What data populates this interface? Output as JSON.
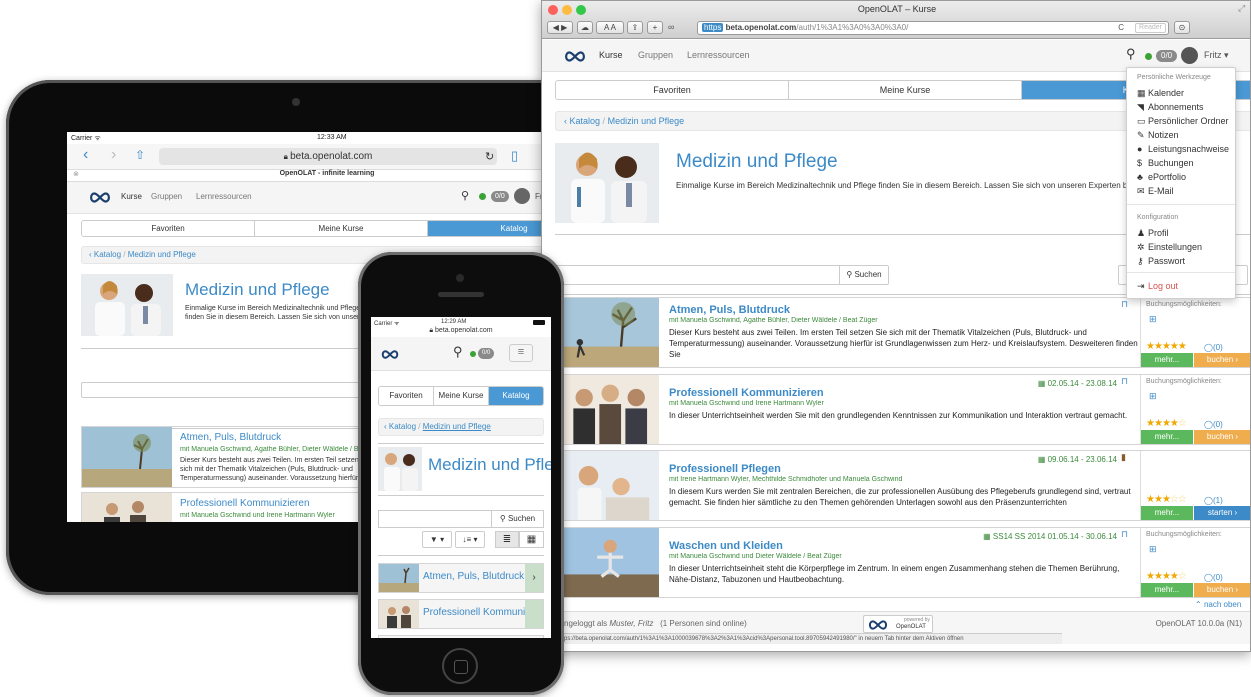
{
  "tablet": {
    "status": {
      "carrier": "Carrier ᯤ",
      "time": "12:33 AM"
    },
    "url": "beta.openolat.com",
    "page_title": "OpenOLAT - infinite learning",
    "nav": {
      "kurse": "Kurse",
      "gruppen": "Gruppen",
      "lern": "Lernressourcen",
      "badge": "0/0",
      "user": "Fr"
    },
    "tabs": [
      "Favoriten",
      "Meine Kurse",
      "Katalog"
    ],
    "crumb": {
      "katalog": "Katalog",
      "sep": "/",
      "current": "Medizin und Pflege"
    },
    "heading": "Medizin und Pflege",
    "desc": "Einmalige Kurse im Bereich Medizinaltechnik und Pflege finden Sie in diesem Bereich. Lassen Sie sich von unseren Experten begleiten und ausbilden.",
    "courses": [
      {
        "title": "Atmen, Puls, Blutdruck",
        "authors": "mit Manuela Gschwind, Agathe Bühler, Dieter Wäldele / Beat Züger",
        "text": "Dieser Kurs besteht aus zwei Teilen. Im ersten Teil setzen Sie sich mit der Thematik Vitalzeichen (Puls, Blutdruck- und Temperaturmessung) auseinander. Voraussetzung hierfür ist Grundlagenwissen zum Herz- und Kreislaufsystem. Desweiteren finden Sie"
      },
      {
        "title": "Professionell Kommunizieren",
        "authors": "mit Manuela Gschwind und Irene Hartmann Wyler"
      }
    ]
  },
  "phone": {
    "status": {
      "carrier": "Carrier ᯤ",
      "time": "12:29 AM"
    },
    "url": "beta.openolat.com",
    "badge": "0/0",
    "tabs": [
      "Favoriten",
      "Meine Kurse",
      "Katalog"
    ],
    "crumb": {
      "katalog": "Katalog",
      "sep": "/",
      "current": "Medizin und Pflege"
    },
    "heading": "Medizin und Pflege",
    "search": "Suchen",
    "courses": [
      "Atmen, Puls, Blutdruck",
      "Professionell Kommunizieren"
    ]
  },
  "browser": {
    "window_title": "OpenOLAT – Kurse",
    "url_prefix": "https",
    "url_host": "beta.openolat.com",
    "url_path": "/auth/1%3A1%3A0%3A0%3A0/",
    "reader": "Reader",
    "reload": "C",
    "nav": {
      "kurse": "Kurse",
      "gruppen": "Gruppen",
      "lern": "Lernressourcen",
      "badge": "0/0",
      "user": "Fritz ▾"
    },
    "tabs": [
      "Favoriten",
      "Meine Kurse",
      "Katalog"
    ],
    "crumb": {
      "katalog": "Katalog",
      "sep": "/",
      "current": "Medizin und Pflege"
    },
    "heading": "Medizin und Pflege",
    "desc": "Einmalige Kurse im Bereich Medizinaltechnik und Pflege finden Sie in diesem Bereich. Lassen Sie sich von unseren Experten begleiten und ausbilden.",
    "search_button": "Suchen",
    "menu": {
      "header1": "Persönliche Werkzeuge",
      "items1": [
        "Kalender",
        "Abonnements",
        "Persönlicher Ordner",
        "Notizen",
        "Leistungsnachweise",
        "Buchungen",
        "ePortfolio",
        "E-Mail"
      ],
      "header2": "Konfiguration",
      "items2": [
        "Profil",
        "Einstellungen",
        "Passwort"
      ],
      "logout": "Log out"
    },
    "courses": [
      {
        "title": "Atmen, Puls, Blutdruck",
        "date": "",
        "authors": "mit Manuela Gschwind, Agathe Bühler, Dieter Wäldele / Beat Züger",
        "text": "Dieser Kurs besteht aus zwei Teilen. Im ersten Teil setzen Sie sich mit der Thematik Vitalzeichen (Puls, Blutdruck- und Temperaturmessung) auseinander. Voraussetzung hierfür ist Grundlagenwissen zum Herz- und Kreislaufsystem. Desweiteren finden Sie",
        "side_label": "Buchungsmöglichkeiten:",
        "rating": 5,
        "comments": "(0)",
        "btn1": "mehr...",
        "btn2": "buchen ›"
      },
      {
        "title": "Professionell Kommunizieren",
        "date": "02.05.14 - 23.08.14",
        "authors": "mit Manuela Gschwind und Irene Hartmann Wyler",
        "text": "In dieser Unterrichtseinheit werden Sie mit den grundlegenden Kenntnissen zur Kommunikation und Interaktion vertraut gemacht.",
        "side_label": "Buchungsmöglichkeiten:",
        "rating": 4,
        "comments": "(0)",
        "btn1": "mehr...",
        "btn2": "buchen ›"
      },
      {
        "title": "Professionell Pflegen",
        "date": "09.06.14 - 23.06.14",
        "authors": "mit Irene Hartmann Wyler, Mechthilde Schmidhofer und Manuela Gschwind",
        "text": "In diesem Kurs werden Sie mit zentralen Bereichen, die zur professionellen Ausübung des Pflegeberufs grundlegend sind, vertraut gemacht. Sie finden hier sämtliche zu den Themen gehörenden Unterlagen sowohl aus den Präsenzunterrichten",
        "side_label": "",
        "rating": 3,
        "comments": "(1)",
        "btn1": "mehr...",
        "btn2": "starten ›"
      },
      {
        "title": "Waschen und Kleiden",
        "date": "SS14 SS 2014 01.05.14 - 30.06.14",
        "authors": "mit Manuela Gschwind und Dieter Wäldele / Beat Züger",
        "text": "In dieser Unterrichtseinheit steht die Körperpflege im Zentrum. In einem engen Zusammenhang stehen die Themen Berührung, Nähe-Distanz, Tabuzonen und Hautbeobachtung.",
        "side_label": "Buchungsmöglichkeiten:",
        "rating": 4,
        "comments": "(0)",
        "btn1": "mehr...",
        "btn2": "buchen ›"
      }
    ],
    "to_top": "nach oben",
    "footer_left_a": "ngeloggt als ",
    "footer_user": "Muster, Fritz",
    "footer_left_b": "(1 Personen sind online)",
    "powered": "powered by",
    "powered_brand": "OpenOLAT",
    "version": "OpenOLAT 10.0.0a (N1)",
    "status_url": "ps://beta.openolat.com/auth/1%3A1%3A1000039678%3A2%3A1%3Acid%3Apersonal.tool.89705942491980/\" in neuem Tab hinter dem Aktiven öffnen"
  },
  "colors": {
    "accent": "#3c8ac7",
    "tab_active": "#4a98d4",
    "green": "#5cb85c",
    "orange": "#f0ad4e",
    "star": "#f0a800"
  }
}
